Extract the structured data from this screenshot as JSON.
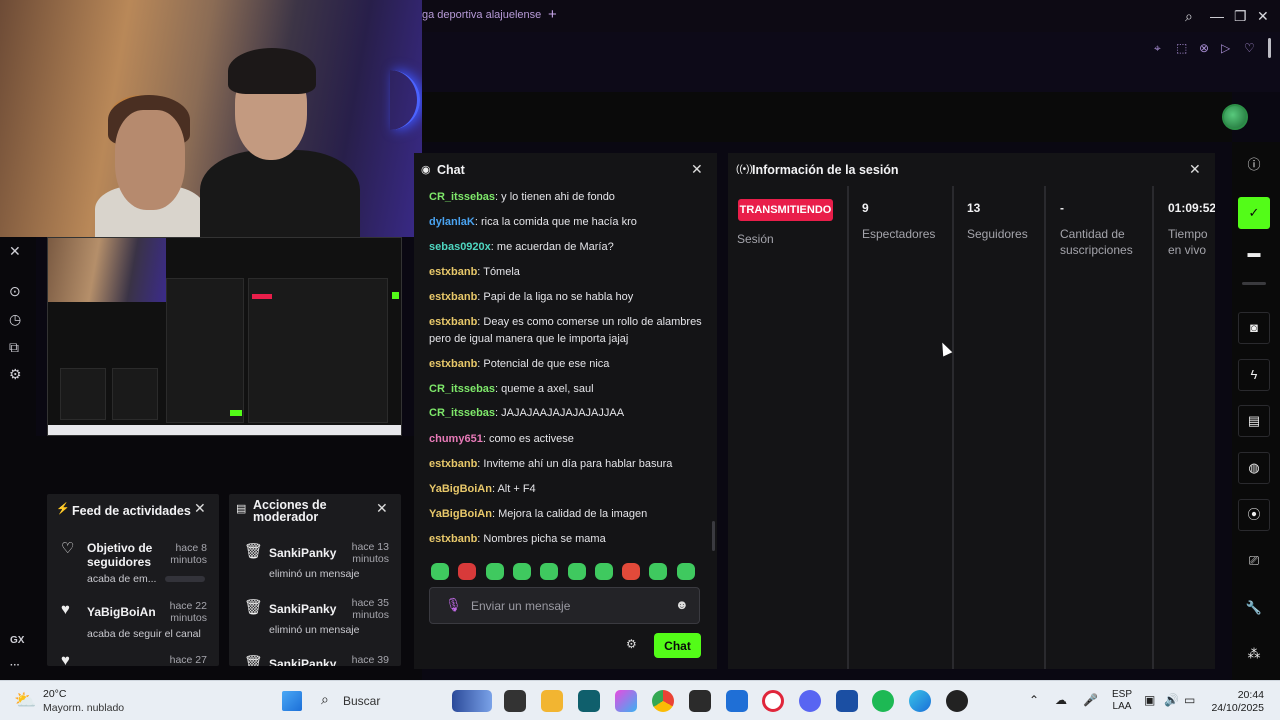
{
  "browser": {
    "tab_title": "ga deportiva alajuelense",
    "tab_add": "+",
    "controls": {
      "search": "⌕",
      "minimize": "—",
      "restore": "❐",
      "close": "✕"
    }
  },
  "left_sidebar": {
    "icons": [
      "x-icon",
      "play-icon",
      "history-icon",
      "extensions-icon",
      "settings-icon"
    ],
    "gx_label": "GX",
    "more": "···"
  },
  "feed": {
    "title": "Feed de actividades",
    "items": [
      {
        "name": "Objetivo de seguidores",
        "time": "hace 8 minutos",
        "sub": "acaba de em..."
      },
      {
        "name": "YaBigBoiAn",
        "time": "hace 22 minutos",
        "sub": "acaba de seguir el canal"
      },
      {
        "name": "",
        "time": "hace 27",
        "sub": ""
      }
    ]
  },
  "mod_actions": {
    "title": "Acciones de moderador",
    "items": [
      {
        "name": "SankiPanky",
        "time": "hace 13 minutos",
        "sub": "eliminó un mensaje"
      },
      {
        "name": "SankiPanky",
        "time": "hace 35 minutos",
        "sub": "eliminó un mensaje"
      },
      {
        "name": "SankiPanky",
        "time": "hace 39",
        "sub": ""
      }
    ]
  },
  "chat": {
    "title": "Chat",
    "messages": [
      {
        "user": "CR_itssebas",
        "color": "#7ee86a",
        "text": "y lo tienen ahi de fondo"
      },
      {
        "user": "dylanlaK",
        "color": "#4aa3f0",
        "text": "rica la comida que me hacía kro"
      },
      {
        "user": "sebas0920x",
        "color": "#4fd6c0",
        "text": "me acuerdan de María?"
      },
      {
        "user": "estxbanb",
        "color": "#e8c86a",
        "text": "Tómela"
      },
      {
        "user": "estxbanb",
        "color": "#e8c86a",
        "text": "Papi de la liga no se habla hoy"
      },
      {
        "user": "estxbanb",
        "color": "#e8c86a",
        "text": "Deay es como comerse un rollo de alambres pero de igual manera que le importa jajaj"
      },
      {
        "user": "estxbanb",
        "color": "#e8c86a",
        "text": "Potencial de que ese nica"
      },
      {
        "user": "CR_itssebas",
        "color": "#7ee86a",
        "text": "queme a axel, saul"
      },
      {
        "user": "CR_itssebas",
        "color": "#7ee86a",
        "text": "JAJAJAAJAJAJAJAJJAA"
      },
      {
        "user": "chumy651",
        "color": "#e87ab8",
        "text": "como es activese"
      },
      {
        "user": "estxbanb",
        "color": "#e8c86a",
        "text": "Inviteme ahí un día para hablar basura"
      },
      {
        "user": "YaBigBoiAn",
        "color": "#e8c86a",
        "text": "Alt + F4"
      },
      {
        "user": "YaBigBoiAn",
        "color": "#e8c86a",
        "text": "Mejora la calidad de la imagen"
      },
      {
        "user": "estxbanb",
        "color": "#e8c86a",
        "text": "Nombres picha se mama"
      }
    ],
    "input_placeholder": "Enviar un mensaje",
    "send_label": "Chat"
  },
  "session": {
    "title": "Información de la sesión",
    "status_badge": "TRANSMITIENDO",
    "status_label": "Sesión",
    "stats": [
      {
        "value": "9",
        "label": "Espectadores"
      },
      {
        "value": "13",
        "label": "Seguidores"
      },
      {
        "value": "-",
        "label": "Cantidad de suscripciones"
      },
      {
        "value": "01:09:52",
        "label": "Tiempo en vivo"
      }
    ]
  },
  "taskbar": {
    "weather_temp": "20°C",
    "weather_desc": "Mayorm. nublado",
    "search": "Buscar",
    "lang_top": "ESP",
    "lang_bottom": "LAA",
    "time": "20:44",
    "date": "24/10/2025"
  },
  "colors": {
    "accent": "#53fc18",
    "live": "#e91e4a",
    "panel": "#141416"
  }
}
